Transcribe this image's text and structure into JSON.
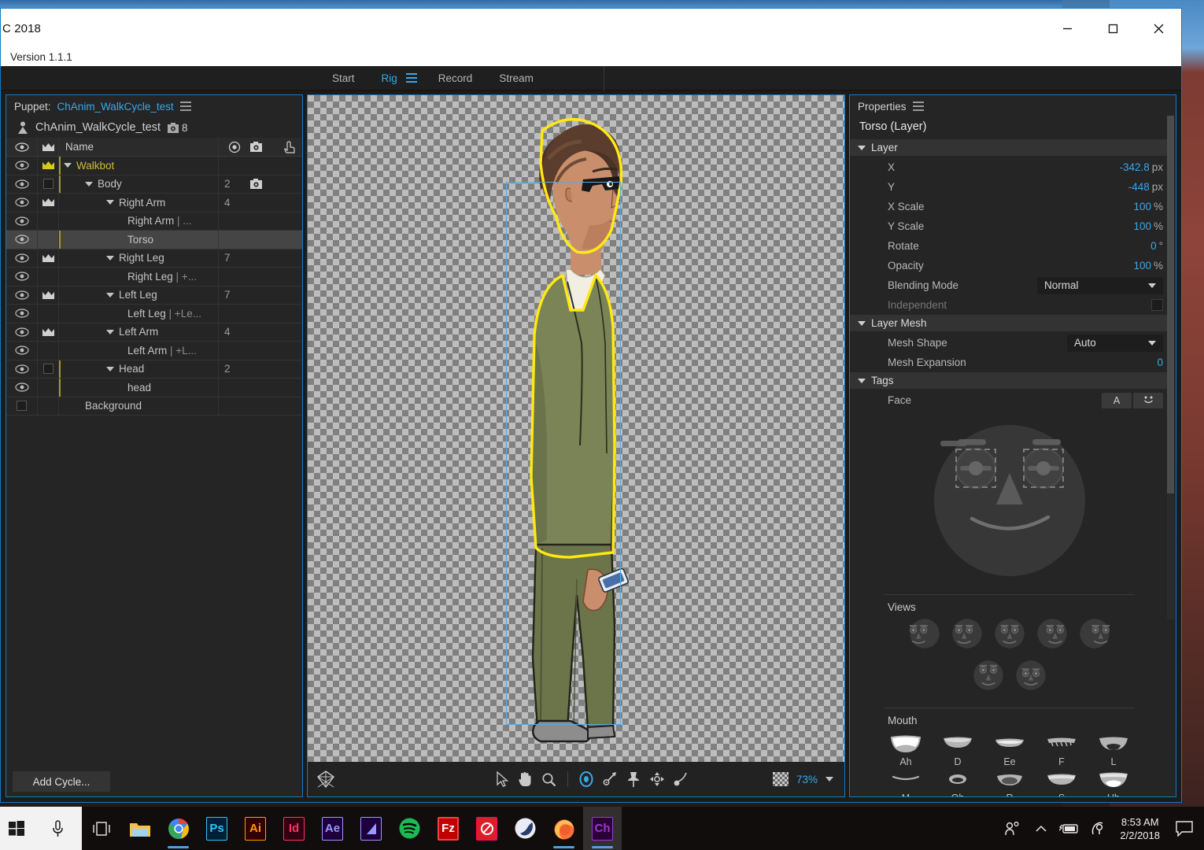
{
  "window": {
    "title": "C 2018",
    "version": "Version 1.1.1",
    "minimize": "minimize-button",
    "maximize": "maximize-button",
    "close": "close-button"
  },
  "tabs": [
    {
      "label": "Start",
      "active": false
    },
    {
      "label": "Rig",
      "active": true
    },
    {
      "label": "Record",
      "active": false
    },
    {
      "label": "Stream",
      "active": false
    }
  ],
  "puppet_panel": {
    "header_label": "Puppet:",
    "header_value": "ChAnim_WalkCycle_test",
    "puppet_name": "ChAnim_WalkCycle_test",
    "mesh_count": "8",
    "columns": {
      "name": "Name",
      "eye": "visibility-column",
      "crown": "crown-column",
      "handles": "handles-column",
      "mesh": "mesh-column",
      "touch": "touch-column"
    },
    "rows": [
      {
        "name": "Walkbot",
        "indent": 0,
        "eye": true,
        "crown": "gold",
        "triangle": true,
        "num": "",
        "cam": false,
        "style": "yellow",
        "guide": true,
        "selected": false
      },
      {
        "name": "Body",
        "indent": 1,
        "eye": true,
        "crown": "box",
        "triangle": true,
        "num": "2",
        "cam": true,
        "style": "normal",
        "guide": true,
        "selected": false
      },
      {
        "name": "Right Arm",
        "indent": 2,
        "eye": true,
        "crown": "gray",
        "triangle": true,
        "num": "4",
        "cam": false,
        "style": "normal",
        "guide": false,
        "selected": false
      },
      {
        "name": "Right Arm",
        "indent": 3,
        "eye": true,
        "crown": "none",
        "triangle": false,
        "num": "",
        "cam": false,
        "style": "normal",
        "guide": false,
        "selected": false,
        "suffix": "| ..."
      },
      {
        "name": "Torso",
        "indent": 3,
        "eye": true,
        "crown": "none",
        "triangle": false,
        "num": "",
        "cam": false,
        "style": "normal",
        "guide": true,
        "selected": true
      },
      {
        "name": "Right Leg",
        "indent": 2,
        "eye": true,
        "crown": "gray",
        "triangle": true,
        "num": "7",
        "cam": false,
        "style": "normal",
        "guide": false,
        "selected": false
      },
      {
        "name": "Right Leg",
        "indent": 3,
        "eye": true,
        "crown": "none",
        "triangle": false,
        "num": "",
        "cam": false,
        "style": "normal",
        "guide": false,
        "selected": false,
        "suffix": "| +..."
      },
      {
        "name": "Left Leg",
        "indent": 2,
        "eye": true,
        "crown": "gray",
        "triangle": true,
        "num": "7",
        "cam": false,
        "style": "normal",
        "guide": false,
        "selected": false
      },
      {
        "name": "Left Leg",
        "indent": 3,
        "eye": true,
        "crown": "none",
        "triangle": false,
        "num": "",
        "cam": false,
        "style": "normal",
        "guide": false,
        "selected": false,
        "suffix": "| +Le..."
      },
      {
        "name": "Left Arm",
        "indent": 2,
        "eye": true,
        "crown": "gray",
        "triangle": true,
        "num": "4",
        "cam": false,
        "style": "normal",
        "guide": false,
        "selected": false
      },
      {
        "name": "Left Arm",
        "indent": 3,
        "eye": true,
        "crown": "none",
        "triangle": false,
        "num": "",
        "cam": false,
        "style": "normal",
        "guide": false,
        "selected": false,
        "suffix": "| +L..."
      },
      {
        "name": "Head",
        "indent": 2,
        "eye": true,
        "crown": "box",
        "triangle": true,
        "num": "2",
        "cam": false,
        "style": "normal",
        "guide": true,
        "selected": false
      },
      {
        "name": "head",
        "indent": 3,
        "eye": true,
        "crown": "none",
        "triangle": false,
        "num": "",
        "cam": false,
        "style": "normal",
        "guide": true,
        "selected": false
      },
      {
        "name": "Background",
        "indent": 1,
        "eye": false,
        "crown": "none",
        "triangle": false,
        "num": "",
        "cam": false,
        "style": "normal",
        "guide": false,
        "selected": false
      }
    ],
    "add_cycle_label": "Add Cycle..."
  },
  "canvas": {
    "zoom": "73%",
    "tools": [
      {
        "name": "origin-icon",
        "active": false
      },
      {
        "name": "selection-arrow-tool",
        "active": false
      },
      {
        "name": "hand-tool",
        "active": false
      },
      {
        "name": "zoom-tool",
        "active": false
      },
      {
        "name": "handle-tool",
        "active": true
      },
      {
        "name": "staple-tool",
        "active": false
      },
      {
        "name": "pin-tool",
        "active": false
      },
      {
        "name": "dragger-tool",
        "active": false
      },
      {
        "name": "stick-tool",
        "active": false
      }
    ],
    "transparency_toggle": "transparency-grid-toggle"
  },
  "properties": {
    "panel_title": "Properties",
    "subject": "Torso (Layer)",
    "sections": {
      "layer": {
        "title": "Layer",
        "rows": [
          {
            "label": "X",
            "value": "-342.8",
            "unit": "px"
          },
          {
            "label": "Y",
            "value": "-448",
            "unit": "px"
          },
          {
            "label": "X Scale",
            "value": "100",
            "unit": "%"
          },
          {
            "label": "Y Scale",
            "value": "100",
            "unit": "%"
          },
          {
            "label": "Rotate",
            "value": "0",
            "unit": "°"
          },
          {
            "label": "Opacity",
            "value": "100",
            "unit": "%"
          }
        ],
        "blending_label": "Blending Mode",
        "blending_value": "Normal",
        "independent_label": "Independent"
      },
      "layer_mesh": {
        "title": "Layer Mesh",
        "mesh_shape_label": "Mesh Shape",
        "mesh_shape_value": "Auto",
        "mesh_expansion_label": "Mesh Expansion",
        "mesh_expansion_value": "0"
      },
      "tags": {
        "title": "Tags",
        "face_label": "Face",
        "tag_a": "A",
        "tag_smiley": "☺"
      }
    },
    "views_title": "Views",
    "views_row1": [
      "view-right-profile",
      "view-right-quarter",
      "view-front",
      "view-left-quarter",
      "view-left-profile"
    ],
    "views_row2": [
      "view-up",
      "view-down"
    ],
    "mouth_title": "Mouth",
    "mouth_row1": [
      "Ah",
      "D",
      "Ee",
      "F",
      "L"
    ],
    "mouth_row2": [
      "M",
      "Oh",
      "R",
      "S",
      "Uh"
    ]
  },
  "taskbar": {
    "start": "windows-start-button",
    "cortana": "cortana-mic-icon",
    "taskview": "task-view-icon",
    "apps": [
      {
        "name": "file-explorer-icon",
        "label": "",
        "color": "#f6c243",
        "running": false
      },
      {
        "name": "google-chrome-icon",
        "label": "",
        "color": "#ffffff",
        "running": true
      },
      {
        "name": "photoshop-icon",
        "label": "Ps",
        "color": "#31c5f0",
        "running": false
      },
      {
        "name": "illustrator-icon",
        "label": "Ai",
        "color": "#ff9a00",
        "running": false
      },
      {
        "name": "indesign-icon",
        "label": "Id",
        "color": "#ff3366",
        "running": false
      },
      {
        "name": "after-effects-icon",
        "label": "Ae",
        "color": "#9999ff",
        "running": false
      },
      {
        "name": "media-encoder-icon",
        "label": "",
        "color": "#9999ff",
        "running": false
      },
      {
        "name": "spotify-icon",
        "label": "",
        "color": "#1db954",
        "running": false
      },
      {
        "name": "filezilla-icon",
        "label": "Fz",
        "color": "#bf0000",
        "running": false
      },
      {
        "name": "creative-cloud-icon",
        "label": "",
        "color": "#da1f26",
        "running": false
      },
      {
        "name": "cinema4d-icon",
        "label": "",
        "color": "#e8e8f0",
        "running": false
      },
      {
        "name": "firefox-icon",
        "label": "",
        "color": "#ff9500",
        "running": true
      },
      {
        "name": "character-animator-icon",
        "label": "Ch",
        "color": "#9a3cc8",
        "running": true
      }
    ],
    "tray": [
      "people-icon",
      "show-hidden-icons-chevron",
      "battery-charging-icon",
      "network-icon"
    ],
    "time": "8:53 AM",
    "date": "2/2/2018",
    "notifications": "action-center-icon"
  }
}
